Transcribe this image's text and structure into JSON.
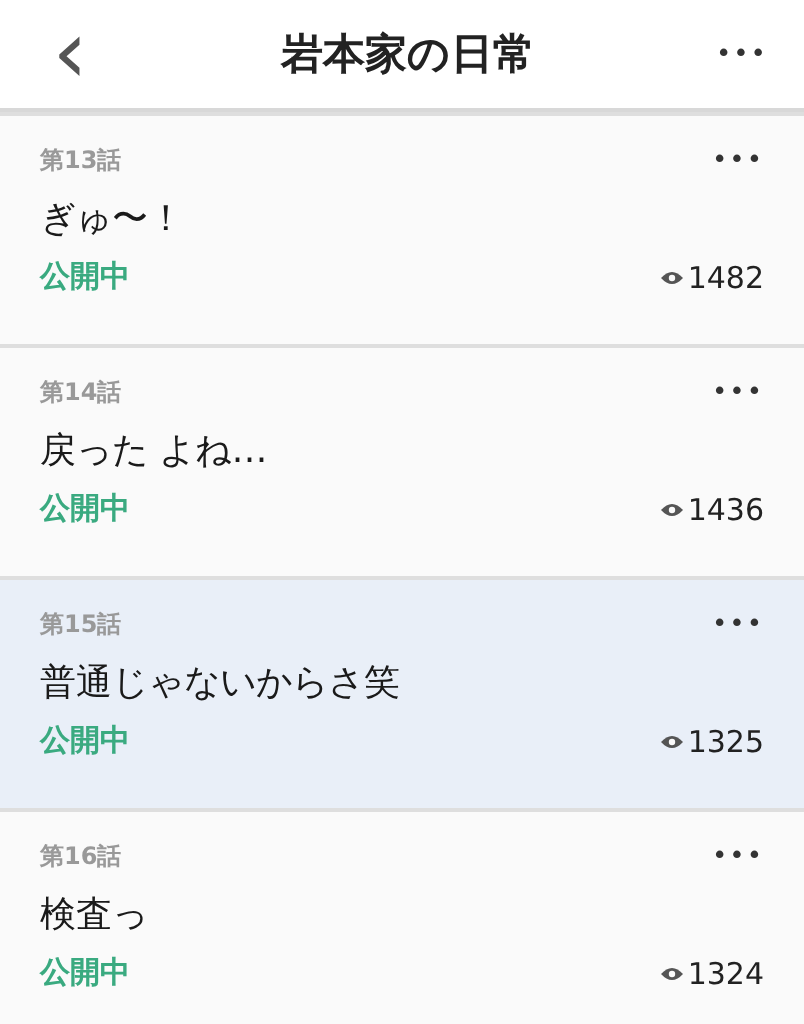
{
  "header": {
    "back": "‹",
    "title": "岩本家の日常",
    "menu": "•••"
  },
  "episodes": [
    {
      "number": "第13話",
      "title": "ぎゅ〜！",
      "status": "公開中",
      "views": "1482",
      "menu": "•••",
      "selected": false
    },
    {
      "number": "第14話",
      "title": "戻った よね…",
      "status": "公開中",
      "views": "1436",
      "menu": "•••",
      "selected": false
    },
    {
      "number": "第15話",
      "title": "普通じゃないからさ笑",
      "status": "公開中",
      "views": "1325",
      "menu": "•••",
      "selected": true
    },
    {
      "number": "第16話",
      "title": "検査っ",
      "status": "公開中",
      "views": "1324",
      "menu": "•••",
      "selected": false
    }
  ]
}
